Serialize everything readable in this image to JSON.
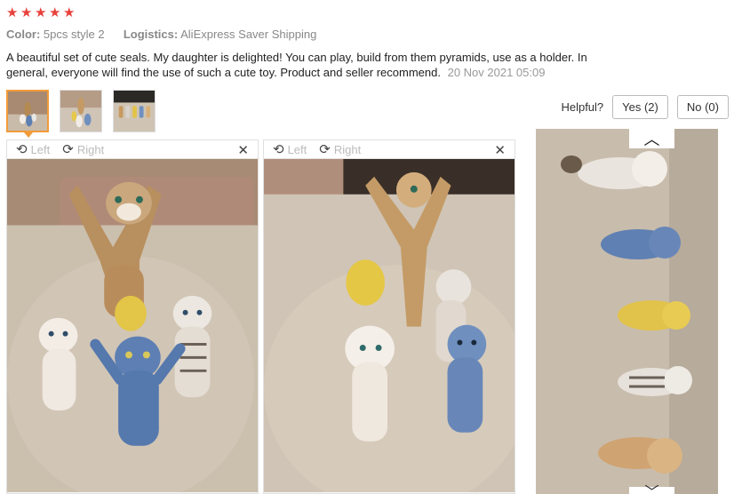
{
  "review": {
    "rating_stars": 5,
    "star_color": "#e8413c",
    "color_label": "Color:",
    "color_value": "5pcs style 2",
    "logistics_label": "Logistics:",
    "logistics_value": "AliExpress Saver Shipping",
    "text": "A beautiful set of cute seals. My daughter is delighted! You can play, build from them pyramids, use as a holder. In general, everyone will find the use of such a cute toy. Product and seller recommend.",
    "date": "20 Nov 2021 05:09"
  },
  "thumbnails": [
    {
      "name": "photo-thumb-1",
      "active": true
    },
    {
      "name": "photo-thumb-2",
      "active": false
    },
    {
      "name": "photo-thumb-3",
      "active": false
    }
  ],
  "helpful": {
    "label": "Helpful?",
    "yes_label": "Yes (2)",
    "no_label": "No (0)"
  },
  "viewer": {
    "rotate_left_label": "Left",
    "rotate_right_label": "Right",
    "icons": {
      "rotate_left": "rotate-left-icon",
      "rotate_right": "rotate-right-icon",
      "close": "close-icon",
      "scroll_up": "chevron-up-icon",
      "scroll_down": "chevron-down-icon"
    }
  },
  "colors": {
    "accent": "#f29b3a",
    "border": "#e0e0e0"
  }
}
